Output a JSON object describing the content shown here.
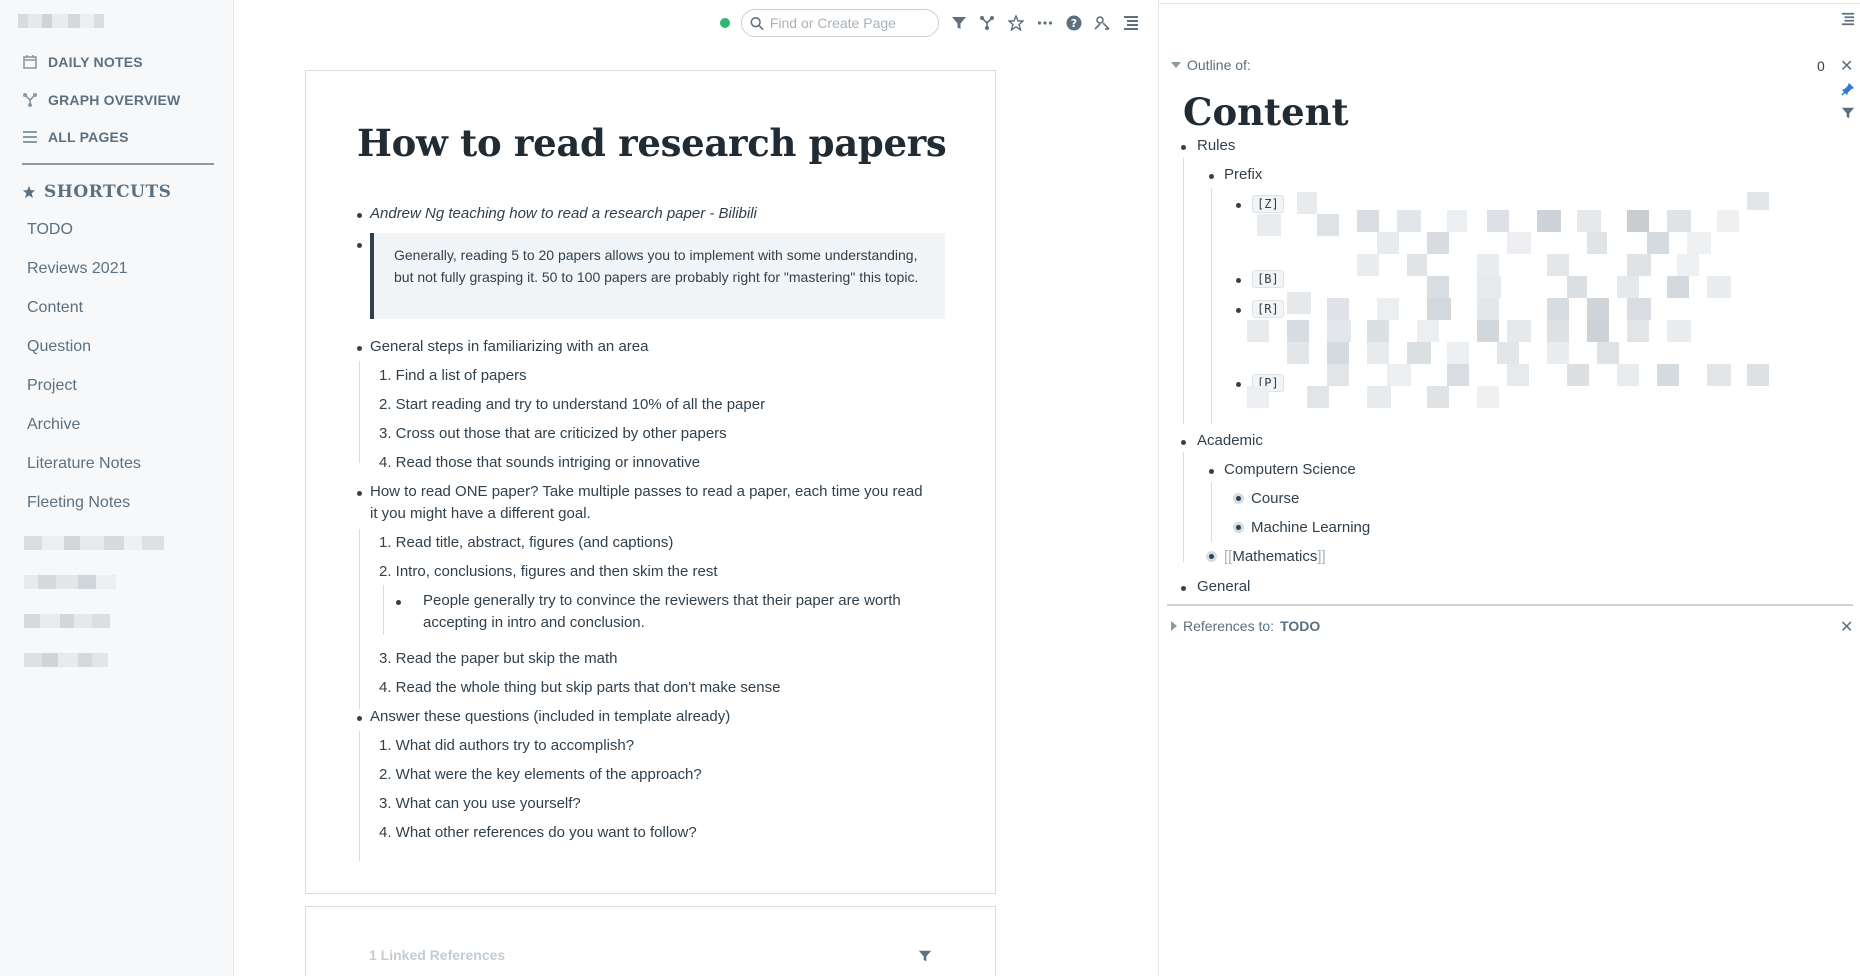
{
  "sidebar": {
    "nav": [
      {
        "label": "DAILY NOTES",
        "icon": "calendar-icon"
      },
      {
        "label": "GRAPH OVERVIEW",
        "icon": "graph-icon"
      },
      {
        "label": "ALL PAGES",
        "icon": "list-icon"
      }
    ],
    "shortcuts_title": "SHORTCUTS",
    "shortcuts": [
      "TODO",
      "Reviews 2021",
      "Content",
      "Question",
      "Project",
      "Archive",
      "Literature Notes",
      "Fleeting Notes"
    ]
  },
  "topbar": {
    "search_placeholder": "Find or Create Page"
  },
  "page": {
    "title": "How to read research papers",
    "link_line": "Andrew Ng teaching how to read a research paper - Bilibili",
    "quote": "Generally, reading 5 to 20 papers allows you to implement with some understanding, but not fully grasping it. 50 to 100 papers are probably right for \"mastering\" this topic.",
    "steps_heading": "General steps in familiarizing with an area",
    "steps": [
      "1.  Find a list of papers",
      "2.  Start reading and try to understand 10% of all the paper",
      "3.  Cross out those that are criticized by other papers",
      "4.  Read those that sounds intriging or innovative"
    ],
    "one_paper_line1": "How to read ONE paper? Take multiple passes to read a paper, each time you read",
    "one_paper_line2": "it you might have a different goal.",
    "passes": [
      "1.  Read title, abstract, figures (and captions)",
      "2.  Intro, conclusions, figures and then skim the rest",
      "3.  Read the paper but skip the math",
      "4.  Read the whole thing but skip parts that don't make sense"
    ],
    "sub_note_line1": "People generally try to convince the reviewers that their paper are worth",
    "sub_note_line2": "accepting in intro and conclusion.",
    "questions_heading": "Answer these questions (included in template already)",
    "questions": [
      "1.  What did authors try to accomplish?",
      "2.  What were the key elements of the approach?",
      "3.  What can you use yourself?",
      "4.  What other references do you want to follow?"
    ],
    "linked_refs": "1 Linked References"
  },
  "right_panel": {
    "outline_label": "Outline of:",
    "count": "0",
    "title": "Content",
    "items": {
      "rules": "Rules",
      "prefix": "Prefix",
      "tags": [
        "[Z]",
        "[B]",
        "[R]",
        "[P]"
      ],
      "academic": "Academic",
      "cs": "Computern Science",
      "course": "Course",
      "ml": "Machine Learning",
      "math_open": "[[",
      "math": "Mathematics",
      "math_close": "]]",
      "general": "General"
    },
    "refs_label": "References to:",
    "refs_target": "TODO"
  }
}
